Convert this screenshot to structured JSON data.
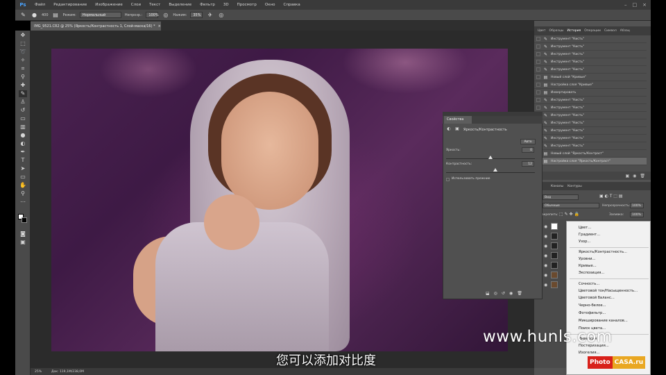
{
  "app": {
    "logo": "Ps",
    "menu": [
      "Файл",
      "Редактирование",
      "Изображение",
      "Слои",
      "Текст",
      "Выделение",
      "Фильтр",
      "3D",
      "Просмотр",
      "Окно",
      "Справка"
    ],
    "window_controls": [
      "–",
      "□",
      "×"
    ]
  },
  "options": {
    "brush_size": "400",
    "mode_label": "Режим:",
    "mode_value": "Нормальный",
    "opacity_label": "Непрозр.:",
    "opacity_value": "100%",
    "flow_label": "Нажим:",
    "flow_value": "35%"
  },
  "document": {
    "tab_title": "IMG_9521.CR2 @ 25% (Яркость/Контрастность 1, Слой-маска/16) *",
    "tab_close": "×",
    "zoom": "25%",
    "doc_info": "Док: 119,1M/238,0M"
  },
  "panels": {
    "tabs": [
      "Цвет",
      "Образцы",
      "История",
      "Операции",
      "Символ",
      "Абзац"
    ],
    "active_tab": "История"
  },
  "history": {
    "items": [
      "Инструмент \"Кисть\"",
      "Инструмент \"Кисть\"",
      "Инструмент \"Кисть\"",
      "Инструмент \"Кисть\"",
      "Инструмент \"Кисть\"",
      "Новый слой \"Кривые\"",
      "Настройка слоя \"Кривые\"",
      "Инвертировать",
      "Инструмент \"Кисть\"",
      "Инструмент \"Кисть\"",
      "Инструмент \"Кисть\"",
      "Инструмент \"Кисть\"",
      "Инструмент \"Кисть\"",
      "Инструмент \"Кисть\"",
      "Инструмент \"Кисть\"",
      "Новый слой \"Яркость/Контраст\"",
      "Настройка слоя \"Яркость/Контраст\""
    ]
  },
  "layers": {
    "tabs": [
      "Каналы",
      "Контуры"
    ],
    "kind": "Вид",
    "blend": "Обычные",
    "opacity_label": "Непрозрачность:",
    "opacity_value": "100%",
    "fill_label": "Заливка:",
    "fill_value": "100%",
    "lock_label": "Закрепить:"
  },
  "properties": {
    "tab": "Свойства",
    "title": "Яркость/Контрастность",
    "auto_label": "Авто",
    "brightness_label": "Яркость:",
    "brightness_value": "0",
    "contrast_label": "Контрастность:",
    "contrast_value": "12",
    "legacy_label": "Использовать прежние"
  },
  "dropdown": {
    "items": [
      "Цвет...",
      "Градиент...",
      "Узор...",
      "Яркость/Контрастность...",
      "Уровни...",
      "Кривые...",
      "Экспозиция...",
      "Сочность...",
      "Цветовой тон/Насыщенность...",
      "Цветовой баланс...",
      "Черно-белое...",
      "Фотофильтр...",
      "Микширование каналов...",
      "Поиск цвета...",
      "Инверсия",
      "Изогелия...",
      "Постеризация..."
    ]
  },
  "overlay": {
    "watermark": "www.hunls.com",
    "subtitle": "您可以添加对比度",
    "logo_a": "Photo",
    "logo_b": "CASA.ru"
  }
}
